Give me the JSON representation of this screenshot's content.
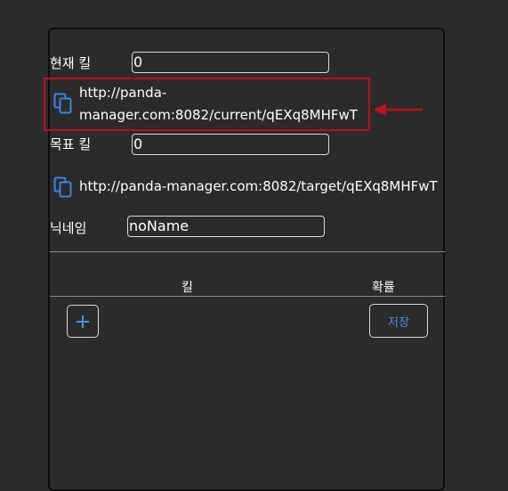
{
  "form": {
    "current_kill_label": "현재 킬",
    "current_kill_value": "0",
    "current_url": "http://panda-manager.com:8082/current/qEXq8MHFwT",
    "current_url_line1": "http://panda-",
    "current_url_line2": "manager.com:8082/current/qEXq8MHFwT",
    "target_kill_label": "목표 킬",
    "target_kill_value": "0",
    "target_url": "http://panda-manager.com:8082/target/qEXq8MHFwT",
    "nickname_label": "닉네임",
    "nickname_value": "noName"
  },
  "table": {
    "col_kill": "킬",
    "col_probability": "확률"
  },
  "actions": {
    "add_label": "+",
    "save_label": "저장"
  },
  "icons": {
    "copy": "copy-icon",
    "arrow": "arrow-left-icon"
  },
  "colors": {
    "background": "#2b2b2b",
    "accent": "#4a90e2",
    "highlight": "#b3121c"
  }
}
